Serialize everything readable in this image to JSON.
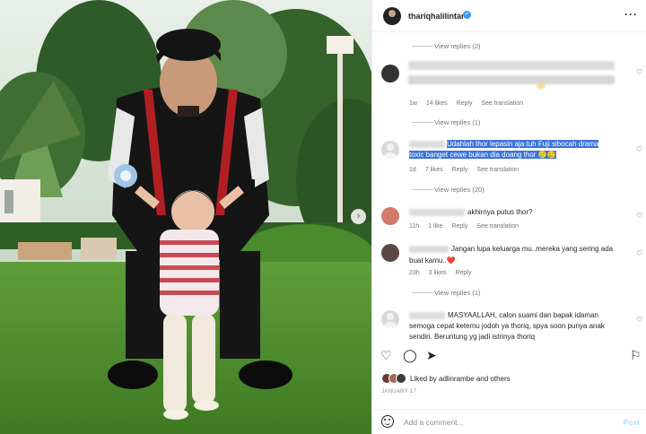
{
  "post": {
    "username": "thariqhalilintar",
    "more_icon": "more-horizontal-icon",
    "verified_icon": "verified-badge-icon"
  },
  "comments": [
    {
      "view_replies": "View replies (2)"
    },
    {
      "meta_time": "1w",
      "meta_likes": "14 likes",
      "meta_reply": "Reply",
      "meta_translate": "See translation",
      "view_replies": "View replies (1)"
    },
    {
      "text_line1": "Udahlah thor lepasin aja tuh Fuji sibocah drama",
      "text_line2": "toxic banget cewe bukan dia doang thor 🥲🥲",
      "meta_time": "1d",
      "meta_likes": "7 likes",
      "meta_reply": "Reply",
      "meta_translate": "See translation",
      "view_replies": "View replies (20)"
    },
    {
      "text": "akhirnya putus thor?",
      "meta_time": "11h",
      "meta_likes": "1 like",
      "meta_reply": "Reply",
      "meta_translate": "See translation"
    },
    {
      "text_line1": "Jangan lupa keluarga mu..mereka yang sering ada",
      "text_line2": "buat kamu..❤️",
      "meta_time": "23h",
      "meta_likes": "3 likes",
      "meta_reply": "Reply",
      "view_replies": "View replies (1)"
    },
    {
      "text_line1": "MASYAALLAH, calon suami dan bapak idaman",
      "text_line2": "semoga cepat ketemu jodoh ya thoriq, spya soon punya anak",
      "text_line3": "sendiri. Beruntung yg jadi istrinya thoriq"
    }
  ],
  "actions": {
    "like_icon": "heart-icon",
    "comment_icon": "comment-icon",
    "share_icon": "share-icon",
    "save_icon": "bookmark-icon"
  },
  "likes_text": "Liked by adlinrambe and others",
  "date": "JANUARY 17",
  "add_comment_placeholder": "Add a comment...",
  "post_button": "Post",
  "colors": {
    "accent": "#0095f6",
    "selection": "#3b73d8",
    "muted": "#737373"
  }
}
